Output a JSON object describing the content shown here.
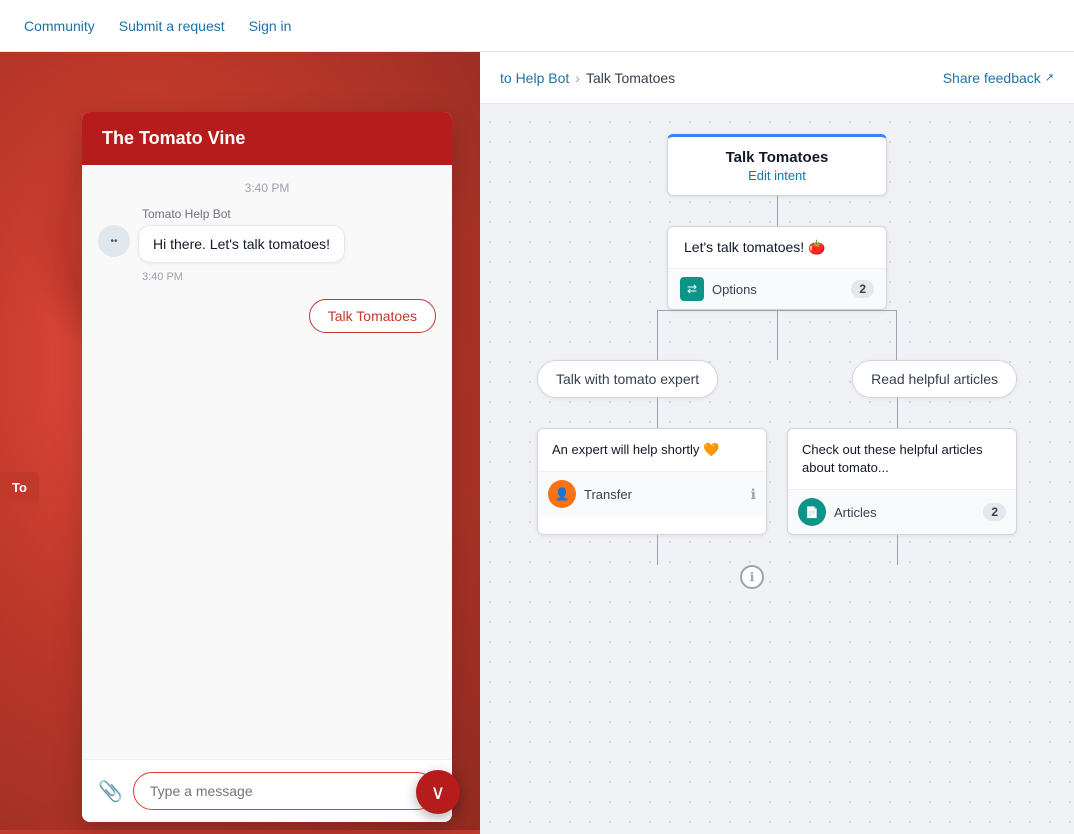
{
  "nav": {
    "links": [
      "Community",
      "Submit a request",
      "Sign in"
    ]
  },
  "header": {
    "share_feedback": "Share feedback",
    "share_icon": "↗"
  },
  "breadcrumb": {
    "parent": "to Help Bot",
    "separator": "›",
    "current": "Talk Tomatoes"
  },
  "chat": {
    "header_title": "The Tomato Vine",
    "timestamp1": "3:40 PM",
    "bot_name": "Tomato Help Bot",
    "message1": "Hi there. Let's talk tomatoes!",
    "timestamp2": "3:40 PM",
    "option_btn": "Talk Tomatoes",
    "input_placeholder": "Type a message",
    "attach_icon": "📎",
    "send_icon": "∨"
  },
  "flow": {
    "top_node_title": "Talk Tomatoes",
    "top_node_subtitle": "Edit intent",
    "message_text": "Let's talk tomatoes! 🍅",
    "options_label": "Options",
    "options_count": "2",
    "branch_left_label": "Talk with tomato expert",
    "branch_right_label": "Read helpful articles",
    "result_left_text": "An expert will help shortly 🧡",
    "result_left_action": "Transfer",
    "result_right_text": "Check out these helpful articles about tomato...",
    "result_right_action": "Articles",
    "result_right_count": "2",
    "bottom_icon": "ℹ"
  },
  "left_tab": "To"
}
